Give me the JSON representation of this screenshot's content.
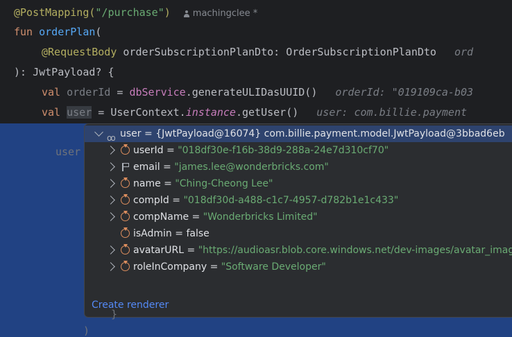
{
  "code": {
    "line1": {
      "annotation": "@PostMapping(",
      "path": "\"/purchase\"",
      "close": ")",
      "author": "machingclee *"
    },
    "line2": {
      "kw": "fun ",
      "fn": "orderPlan",
      "rest": "("
    },
    "line3": {
      "annotation": "@RequestBody ",
      "param": "orderSubscriptionPlanDto: OrderSubscriptionPlanDto",
      "hint": "ord"
    },
    "line4": {
      "text": "): JwtPayload? {"
    },
    "line5": {
      "kw": "val ",
      "var": "orderId",
      "eq": " = ",
      "obj": "dbService",
      "call": ".generateULIDasUUID()",
      "hint": "orderId: \"019109ca-b03"
    },
    "line6": {
      "kw": "val ",
      "var": "user",
      "eq": " = UserContext.",
      "prop": "instance",
      "call": ".getUser()",
      "hint": "user: com.billie.payment"
    },
    "ghost_user": "user",
    "ghost_brace1": "}",
    "ghost_brace2": ")"
  },
  "popup": {
    "root": {
      "name": "user",
      "value": "{JwtPayload@16074} com.billie.payment.model.JwtPayload@3bbad6eb"
    },
    "fields": [
      {
        "name": "userId",
        "value": "\"018df30e-f16b-38d9-288a-24e7d310cf70\"",
        "icon": "field-icon",
        "expandable": true,
        "string": true
      },
      {
        "name": "email",
        "value": "\"james.lee@wonderbricks.com\"",
        "icon": "flag-icon",
        "expandable": true,
        "string": true
      },
      {
        "name": "name",
        "value": "\"Ching-Cheong Lee\"",
        "icon": "field-icon",
        "expandable": true,
        "string": true
      },
      {
        "name": "compId",
        "value": "\"018df30d-a488-c1c7-4957-d782b1e1c433\"",
        "icon": "field-icon",
        "expandable": true,
        "string": true
      },
      {
        "name": "compName",
        "value": "\"Wonderbricks Limited\"",
        "icon": "field-icon",
        "expandable": true,
        "string": true
      },
      {
        "name": "isAdmin",
        "value": "false",
        "icon": "field-icon",
        "expandable": false,
        "string": false
      },
      {
        "name": "avatarURL",
        "value": "\"https://audioasr.blob.core.windows.net/dev-images/avatar_image_ja",
        "icon": "field-icon",
        "expandable": true,
        "string": true
      },
      {
        "name": "roleInCompany",
        "value": "\"Software Developer\"",
        "icon": "field-icon",
        "expandable": true,
        "string": true
      }
    ],
    "create_renderer": "Create renderer"
  },
  "colors": {
    "selection": "#214283",
    "popup_bg": "#2b2d30",
    "string": "#6aab73",
    "keyword": "#cf8e6d",
    "link": "#548af7"
  }
}
